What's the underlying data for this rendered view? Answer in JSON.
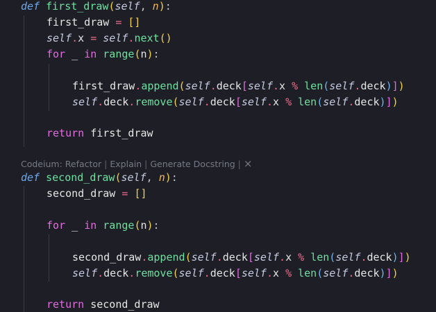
{
  "editor": {
    "codelens": {
      "prefix": "Codeium: ",
      "actions": [
        "Refactor",
        "Explain",
        "Generate Docstring"
      ],
      "separator": " | ",
      "close": "×"
    },
    "tokens": {
      "def": "def",
      "self": "self",
      "n": "n",
      "for": "for",
      "underscore": "_",
      "in": "in",
      "range": "range",
      "return": "return",
      "len": "len",
      "append": "append",
      "remove": "remove",
      "next": "next",
      "deck": "deck",
      "x": "x",
      "first_draw": "first_draw",
      "second_draw": "second_draw",
      "eq": "=",
      "pct": "%",
      "dot": ".",
      "comma": ", ",
      "colon": ":",
      "lparen": "(",
      "rparen": ")",
      "lbrack": "[",
      "rbrack": "]",
      "empty_list": "[]"
    }
  }
}
